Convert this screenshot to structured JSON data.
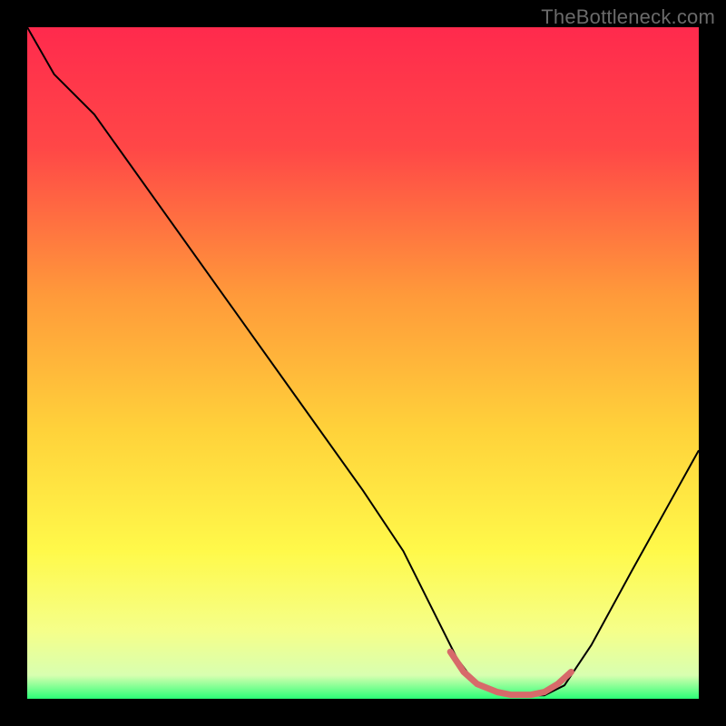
{
  "watermark": "TheBottleneck.com",
  "chart_data": {
    "type": "line",
    "title": "",
    "xlabel": "",
    "ylabel": "",
    "xlim": [
      0,
      100
    ],
    "ylim": [
      0,
      100
    ],
    "grid": false,
    "legend": false,
    "series": [
      {
        "name": "curve",
        "color": "#000000",
        "x": [
          0,
          4,
          10,
          20,
          30,
          40,
          50,
          56,
          60,
          64,
          67,
          72,
          77,
          80,
          84,
          90,
          95,
          100
        ],
        "y": [
          100,
          93,
          87,
          73,
          59,
          45,
          31,
          22,
          14,
          6,
          2,
          0.5,
          0.5,
          2,
          8,
          19,
          28,
          37
        ]
      },
      {
        "name": "highlight",
        "color": "#d76a6a",
        "x": [
          63,
          65,
          67,
          70,
          72,
          75,
          77,
          79,
          81
        ],
        "y": [
          7,
          4,
          2.2,
          1.0,
          0.6,
          0.6,
          1.0,
          2.2,
          4
        ]
      }
    ],
    "background_gradient": {
      "stops": [
        {
          "offset": 0.0,
          "color": "#ff2a4d"
        },
        {
          "offset": 0.18,
          "color": "#ff4747"
        },
        {
          "offset": 0.4,
          "color": "#ff9a3a"
        },
        {
          "offset": 0.6,
          "color": "#ffd23a"
        },
        {
          "offset": 0.78,
          "color": "#fff94a"
        },
        {
          "offset": 0.9,
          "color": "#f5ff8a"
        },
        {
          "offset": 0.965,
          "color": "#d8ffb0"
        },
        {
          "offset": 1.0,
          "color": "#2bff77"
        }
      ]
    }
  }
}
